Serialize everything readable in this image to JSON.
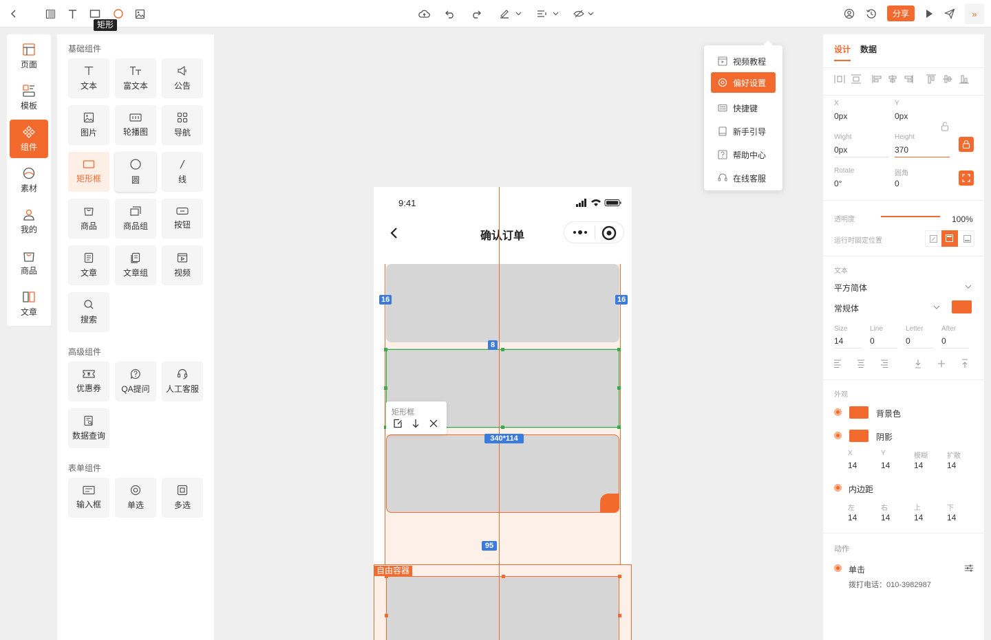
{
  "toolbar": {
    "tooltip": "矩形",
    "share_label": "分享"
  },
  "rail": {
    "items": [
      {
        "label": "页面",
        "icon": "page-icon"
      },
      {
        "label": "模板",
        "icon": "template-icon"
      },
      {
        "label": "组件",
        "icon": "component-icon"
      },
      {
        "label": "素材",
        "icon": "material-icon"
      },
      {
        "label": "我的",
        "icon": "user-icon"
      },
      {
        "label": "商品",
        "icon": "goods-icon"
      },
      {
        "label": "文章",
        "icon": "article-icon"
      }
    ],
    "active": "组件"
  },
  "panel": {
    "basic_title": "基础组件",
    "basic": [
      "文本",
      "富文本",
      "公告",
      "图片",
      "轮播图",
      "导航",
      "矩形框",
      "圆",
      "线",
      "商品",
      "商品组",
      "按钮",
      "文章",
      "文章组",
      "视频",
      "搜索"
    ],
    "advanced_title": "高级组件",
    "advanced": [
      "优惠券",
      "QA提问",
      "人工客服",
      "数据查询"
    ],
    "form_title": "表单组件",
    "form": [
      "输入框",
      "单选",
      "多选"
    ]
  },
  "phone": {
    "time": "9:41",
    "title": "确认订单",
    "badges": {
      "left": "16",
      "right": "16",
      "gap": "8",
      "size": "340*114",
      "spacing": "95"
    },
    "rect_popup_label": "矩形框",
    "container_label": "自由容器"
  },
  "menu": {
    "items": [
      "视频教程",
      "偏好设置",
      "快捷键",
      "新手引导",
      "帮助中心",
      "在线客服"
    ],
    "active": "偏好设置"
  },
  "props": {
    "tabs": [
      "设计",
      "数据"
    ],
    "x_label": "X",
    "x_value": "0px",
    "y_label": "Y",
    "y_value": "0px",
    "w_label": "Wight",
    "w_value": "0px",
    "h_label": "Height",
    "h_value": "370",
    "rotate_label": "Rotate",
    "rotate_value": "0°",
    "radius_label": "圆角",
    "radius_value": "0",
    "opacity_label": "透明度",
    "opacity_value": "100%",
    "opacity": 1.0,
    "fixed_label": "运行时固定位置",
    "text_title": "文本",
    "font_family": "平方简体",
    "font_style": "常规体",
    "size_label": "Size",
    "size_value": "14",
    "line_label": "Line",
    "line_value": "0",
    "letter_label": "Letter",
    "letter_value": "0",
    "after_label": "After",
    "after_value": "0",
    "appearance_title": "外观",
    "bg_label": "背景色",
    "shadow_label": "阴影",
    "shadow_fields": [
      {
        "label": "X",
        "value": "14"
      },
      {
        "label": "Y",
        "value": "14"
      },
      {
        "label": "模糊",
        "value": "14"
      },
      {
        "label": "扩散",
        "value": "14"
      }
    ],
    "padding_label": "内边距",
    "padding_fields": [
      {
        "label": "左",
        "value": "14"
      },
      {
        "label": "右",
        "value": "14"
      },
      {
        "label": "上",
        "value": "14"
      },
      {
        "label": "下",
        "value": "14"
      }
    ],
    "action_title": "动作",
    "action_label": "单击",
    "action_detail": "拨打电话：010-3982987"
  },
  "colors": {
    "accent": "#f26a2e",
    "badge": "#3a7bdc",
    "selection": "#3caa4a"
  }
}
